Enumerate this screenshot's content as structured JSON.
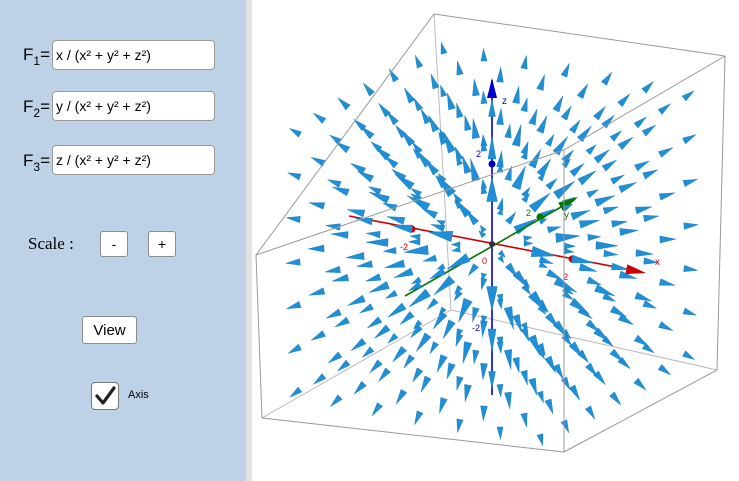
{
  "inputs": [
    {
      "label_main": "F",
      "label_sub": "1",
      "label_eq": "=",
      "value": "x / (x² + y² + z²)"
    },
    {
      "label_main": "F",
      "label_sub": "2",
      "label_eq": "=",
      "value": "y / (x² + y² + z²)"
    },
    {
      "label_main": "F",
      "label_sub": "3",
      "label_eq": "=",
      "value": "z / (x² + y² + z²)"
    }
  ],
  "scale": {
    "label": "Scale :",
    "minus": "-",
    "plus": "+"
  },
  "view_button": "View",
  "axis_checkbox": {
    "label": "Axis",
    "checked": true
  },
  "view3d": {
    "colors": {
      "x_axis": "#cc0000",
      "y_axis": "#007700",
      "z_axis": "#0000cc",
      "arrows": "#1f8fd8",
      "box": "#999999"
    },
    "axes": {
      "x": {
        "name": "x",
        "ticks": [
          "-2",
          "0",
          "2"
        ]
      },
      "y": {
        "name": "y",
        "ticks": [
          "2"
        ]
      },
      "z": {
        "name": "z",
        "ticks": [
          "2",
          "-2"
        ]
      }
    }
  }
}
